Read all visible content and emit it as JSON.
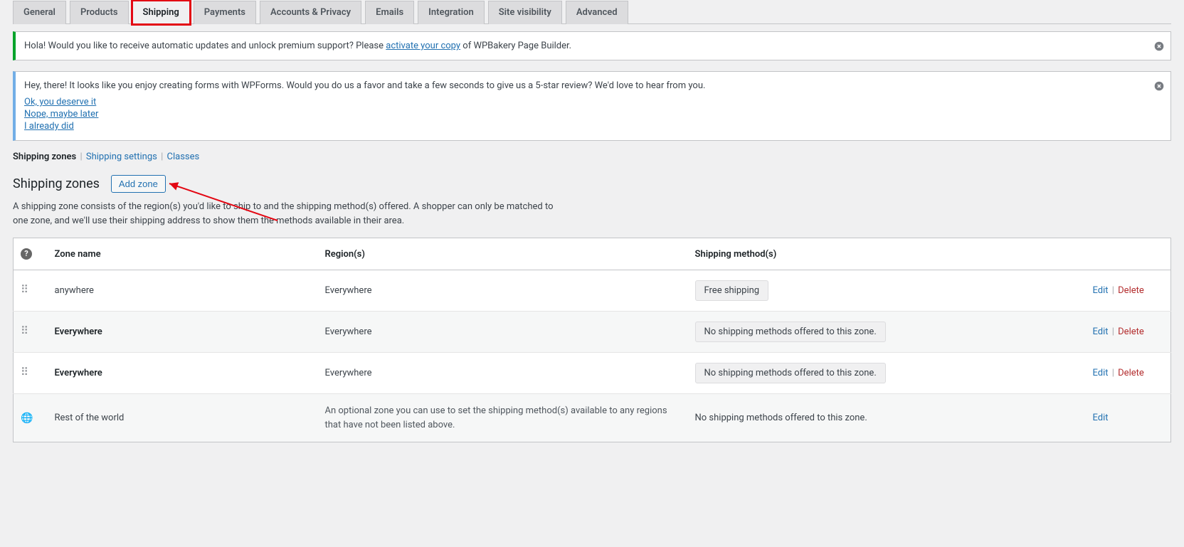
{
  "tabs": [
    "General",
    "Products",
    "Shipping",
    "Payments",
    "Accounts & Privacy",
    "Emails",
    "Integration",
    "Site visibility",
    "Advanced"
  ],
  "activeTab": "Shipping",
  "notice1": {
    "pre": "Hola! Would you like to receive automatic updates and unlock premium support? Please ",
    "link": "activate your copy",
    "post": " of WPBakery Page Builder."
  },
  "notice2": {
    "text": "Hey, there! It looks like you enjoy creating forms with WPForms. Would you do us a favor and take a few seconds to give us a 5-star review? We'd love to hear from you.",
    "links": [
      "Ok, you deserve it",
      "Nope, maybe later",
      "I already did"
    ]
  },
  "subsub": {
    "current": "Shipping zones",
    "settings": "Shipping settings",
    "classes": "Classes"
  },
  "page": {
    "title": "Shipping zones",
    "addBtn": "Add zone",
    "desc": "A shipping zone consists of the region(s) you'd like to ship to and the shipping method(s) offered. A shopper can only be matched to one zone, and we'll use their shipping address to show them the methods available in their area."
  },
  "table": {
    "headers": {
      "name": "Zone name",
      "region": "Region(s)",
      "method": "Shipping method(s)"
    },
    "rows": [
      {
        "name": "anywhere",
        "bold": false,
        "region": "Everywhere",
        "method": "Free shipping",
        "methodChip": true,
        "actions": [
          "Edit",
          "Delete"
        ],
        "alt": false
      },
      {
        "name": "Everywhere",
        "bold": true,
        "region": "Everywhere",
        "method": "No shipping methods offered to this zone.",
        "methodChip": true,
        "actions": [
          "Edit",
          "Delete"
        ],
        "alt": true
      },
      {
        "name": "Everywhere",
        "bold": true,
        "region": "Everywhere",
        "method": "No shipping methods offered to this zone.",
        "methodChip": true,
        "actions": [
          "Edit",
          "Delete"
        ],
        "alt": false
      }
    ],
    "rest": {
      "name": "Rest of the world",
      "region": "An optional zone you can use to set the shipping method(s) available to any regions that have not been listed above.",
      "method": "No shipping methods offered to this zone.",
      "action": "Edit"
    },
    "editLabel": "Edit",
    "deleteLabel": "Delete"
  }
}
